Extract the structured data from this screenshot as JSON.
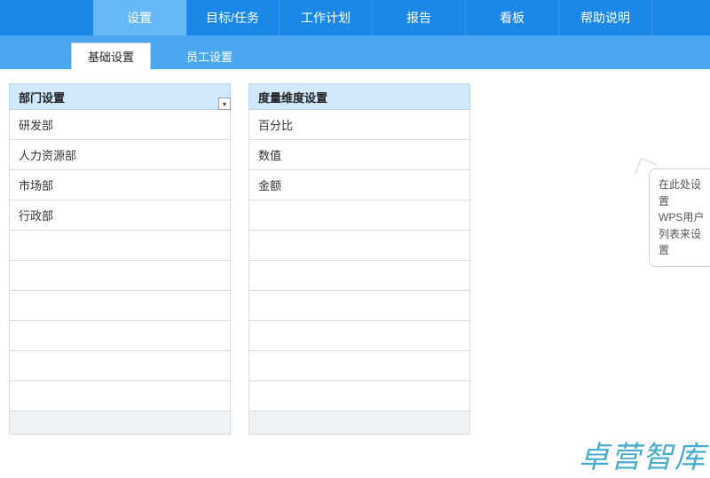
{
  "topnav": {
    "tabs": [
      {
        "label": "设置",
        "active": true
      },
      {
        "label": "目标/任务",
        "active": false
      },
      {
        "label": "工作计划",
        "active": false
      },
      {
        "label": "报告",
        "active": false
      },
      {
        "label": "看板",
        "active": false
      },
      {
        "label": "帮助说明",
        "active": false
      }
    ]
  },
  "subnav": {
    "tabs": [
      {
        "label": "基础设置",
        "active": true
      },
      {
        "label": "员工设置",
        "active": false
      }
    ]
  },
  "panels": {
    "department": {
      "title": "部门设置",
      "has_dropdown": true,
      "total_rows": 10,
      "items": [
        "研发部",
        "人力资源部",
        "市场部",
        "行政部"
      ]
    },
    "metric": {
      "title": "度量维度设置",
      "has_dropdown": false,
      "total_rows": 10,
      "items": [
        "百分比",
        "数值",
        "金额"
      ]
    }
  },
  "tip": {
    "lines": [
      "在此处设置",
      "WPS用户",
      "列表来设置"
    ]
  },
  "watermark": "卓营智库"
}
